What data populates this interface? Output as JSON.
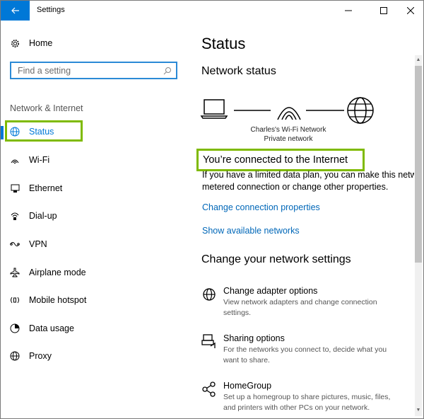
{
  "window": {
    "title": "Settings",
    "accent": "#0078d7",
    "highlight": "#7fba00"
  },
  "sidebar": {
    "home_label": "Home",
    "search_placeholder": "Find a setting",
    "section_label": "Network & Internet",
    "items": [
      {
        "label": "Status",
        "icon": "globe-icon",
        "active": true
      },
      {
        "label": "Wi-Fi",
        "icon": "wifi-icon"
      },
      {
        "label": "Ethernet",
        "icon": "ethernet-icon"
      },
      {
        "label": "Dial-up",
        "icon": "dialup-icon"
      },
      {
        "label": "VPN",
        "icon": "vpn-icon"
      },
      {
        "label": "Airplane mode",
        "icon": "airplane-icon"
      },
      {
        "label": "Mobile hotspot",
        "icon": "hotspot-icon"
      },
      {
        "label": "Data usage",
        "icon": "data-usage-icon"
      },
      {
        "label": "Proxy",
        "icon": "globe-icon"
      }
    ]
  },
  "main": {
    "title": "Status",
    "network_status_heading": "Network status",
    "network_name": "Charles's Wi-Fi Network",
    "network_type": "Private network",
    "connected_text": "You’re connected to the Internet",
    "info_line1": "If you have a limited data plan, you can make this netw",
    "info_line2": "metered connection or change other properties.",
    "change_props_link": "Change connection properties",
    "show_networks_link": "Show available networks",
    "change_settings_heading": "Change your network settings",
    "options": [
      {
        "title": "Change adapter options",
        "desc_line1": "View network adapters and change connection",
        "desc_line2": "settings.",
        "icon": "adapter-icon"
      },
      {
        "title": "Sharing options",
        "desc_line1": "For the networks you connect to, decide what you",
        "desc_line2": "want to share.",
        "icon": "sharing-icon"
      },
      {
        "title": "HomeGroup",
        "desc_line1": "Set up a homegroup to share pictures, music, files,",
        "desc_line2": "and printers with other PCs on your network.",
        "icon": "homegroup-icon"
      }
    ]
  }
}
